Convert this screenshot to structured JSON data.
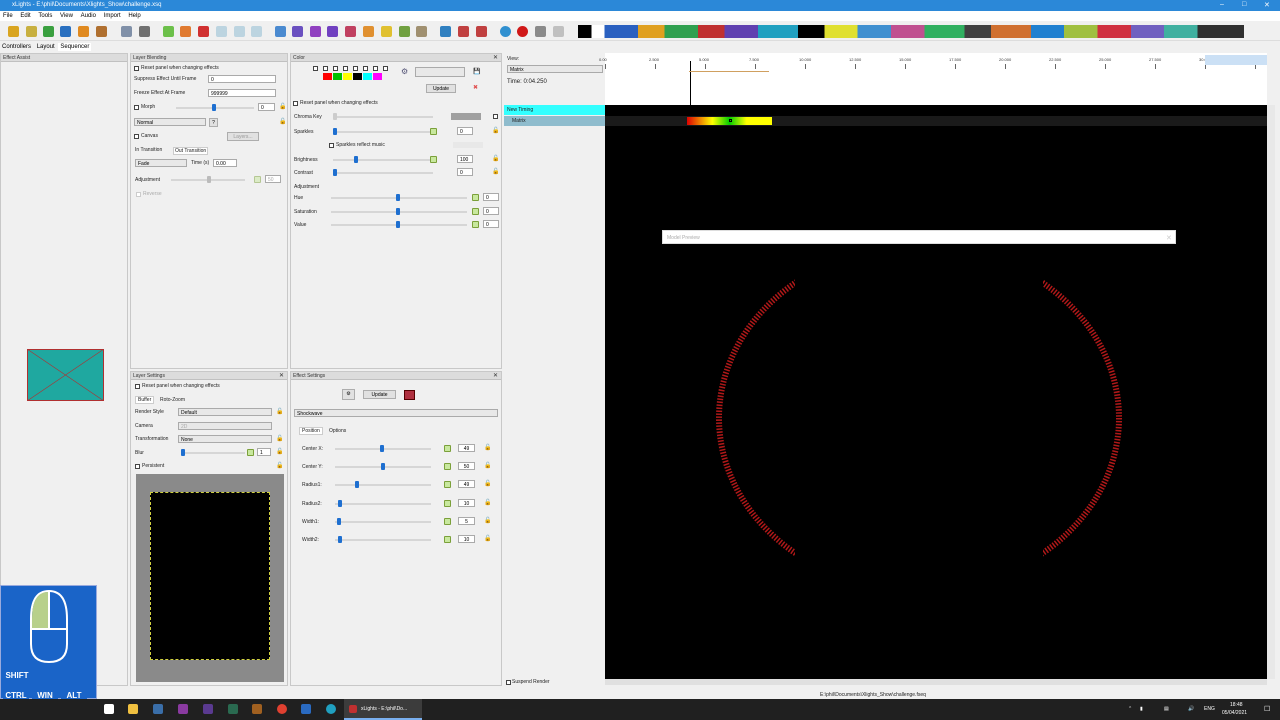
{
  "window": {
    "title": "xLights - E:\\phil\\Documents\\Xlights_Show\\challenge.xsq"
  },
  "menu": [
    "File",
    "Edit",
    "Tools",
    "View",
    "Audio",
    "Import",
    "Help"
  ],
  "tabs": [
    "Controllers",
    "Layout",
    "Sequencer"
  ],
  "effect_assist": {
    "title": "Effect Assist"
  },
  "layer_blending": {
    "title": "Layer Blending",
    "reset_label": "Reset panel when changing effects",
    "suppress_label": "Suppress Effect Until Frame",
    "suppress_value": "0",
    "freeze_label": "Freeze Effect At Frame",
    "freeze_value": "999999",
    "morph_label": "Morph",
    "morph_value": "0",
    "blend_mode": "Normal",
    "help_btn": "?",
    "canvas_label": "Canvas",
    "layers_btn": "Layers...",
    "in_transition": "In Transition",
    "out_transition": "Out Transition",
    "fade": "Fade",
    "time_label": "Time (s)",
    "time_value": "0.00",
    "adjustment_label": "Adjustment",
    "adjustment_value": "50",
    "reverse_label": "Reverse"
  },
  "color": {
    "title": "Color",
    "update_btn": "Update",
    "reset_label": "Reset panel when changing effects",
    "chroma_label": "Chroma Key",
    "sparkles_label": "Sparkles",
    "sparkles_value": "0",
    "sparkles_music_label": "Sparkles reflect music",
    "brightness_label": "Brightness",
    "brightness_value": "100",
    "contrast_label": "Contrast",
    "contrast_value": "0",
    "adjustment_label": "Adjustment",
    "hue_label": "Hue",
    "hue_value": "0",
    "saturation_label": "Saturation",
    "saturation_value": "0",
    "value_label": "Value",
    "value_value": "0",
    "palette": [
      "#ff0000",
      "#00c000",
      "#ffff00",
      "#000000",
      "#00ffff",
      "#ff00ff"
    ]
  },
  "layer_settings": {
    "title": "Layer Settings",
    "reset_label": "Reset panel when changing effects",
    "tab_buffer": "Buffer",
    "tab_roto": "Roto-Zoom",
    "render_style_label": "Render Style",
    "render_style_value": "Default",
    "camera_label": "Camera",
    "camera_value": "2D",
    "transformation_label": "Transformation",
    "transformation_value": "None",
    "blur_label": "Blur",
    "blur_value": "1",
    "persistent_label": "Persistent"
  },
  "effect_settings": {
    "title": "Effect Settings",
    "update_btn": "Update",
    "effect_name": "Shockwave",
    "tab_position": "Position",
    "tab_options": "Options",
    "rows": [
      {
        "label": "Center X:",
        "value": "49",
        "pos": 0.49
      },
      {
        "label": "Center Y:",
        "value": "50",
        "pos": 0.5
      },
      {
        "label": "Radius1:",
        "value": "49",
        "pos": 0.23
      },
      {
        "label": "Radius2:",
        "value": "10",
        "pos": 0.05
      },
      {
        "label": "Width1:",
        "value": "5",
        "pos": 0.04
      },
      {
        "label": "Width2:",
        "value": "10",
        "pos": 0.05
      }
    ]
  },
  "sequencer": {
    "view_label": "View:",
    "view_value": "Matrix",
    "time_label": "Time: 0:04.250",
    "ticks": [
      "0.00",
      "2.500",
      "5.000",
      "7.500",
      "10.000",
      "12.500",
      "15.000",
      "17.500",
      "20.000",
      "22.500",
      "25.000",
      "27.500",
      "30.000",
      "32.500"
    ],
    "rows": [
      "New Timing",
      "Matrix"
    ],
    "suspend_render": "Suspend Render",
    "status_path": "E:\\phil\\Documents\\Xlights_Show\\challenge.fseq"
  },
  "model_preview": {
    "title": "Model Preview",
    "ring_color": "#b01818"
  },
  "keys": [
    "SHIFT",
    "CTRL",
    "WIN",
    "ALT"
  ],
  "taskbar": {
    "app_label": "xLights - E:\\phil\\Do...",
    "lang": "ENG",
    "time": "18:48",
    "date": "05/04/2021"
  }
}
